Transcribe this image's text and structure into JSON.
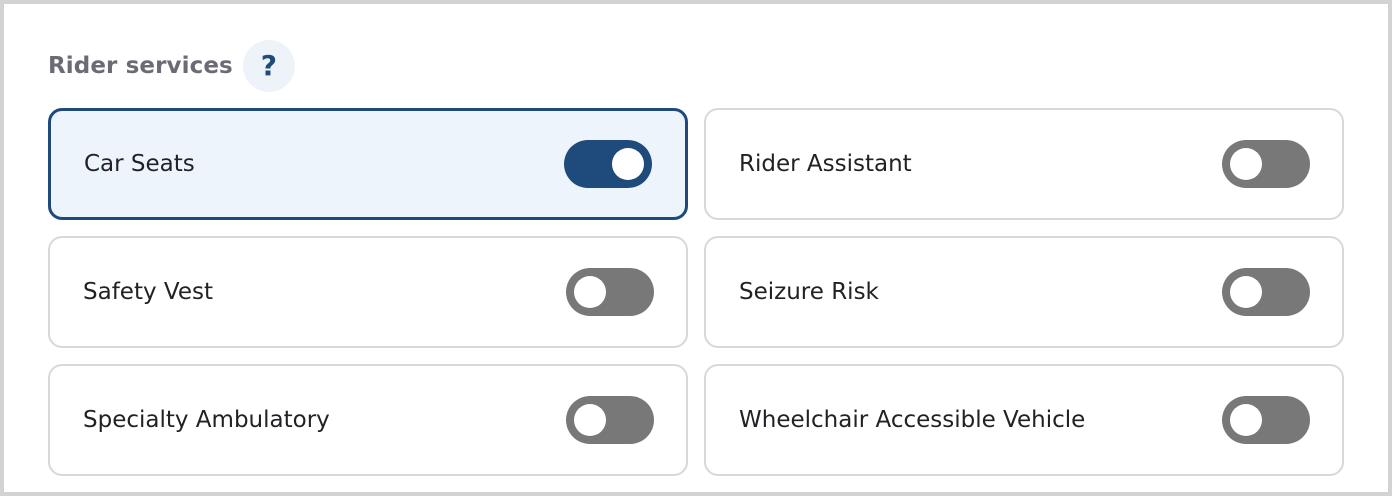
{
  "section": {
    "title": "Rider services",
    "help_icon": "question-mark-icon",
    "help_glyph": "?"
  },
  "colors": {
    "accent": "#1e4a7c",
    "toggle_off": "#787878",
    "selected_bg": "#eef4fc",
    "card_border": "#d8d8d8",
    "title_text": "#6b6b75"
  },
  "services": [
    {
      "label": "Car Seats",
      "enabled": true
    },
    {
      "label": "Rider Assistant",
      "enabled": false
    },
    {
      "label": "Safety Vest",
      "enabled": false
    },
    {
      "label": "Seizure Risk",
      "enabled": false
    },
    {
      "label": "Specialty Ambulatory",
      "enabled": false
    },
    {
      "label": "Wheelchair Accessible Vehicle",
      "enabled": false
    }
  ]
}
